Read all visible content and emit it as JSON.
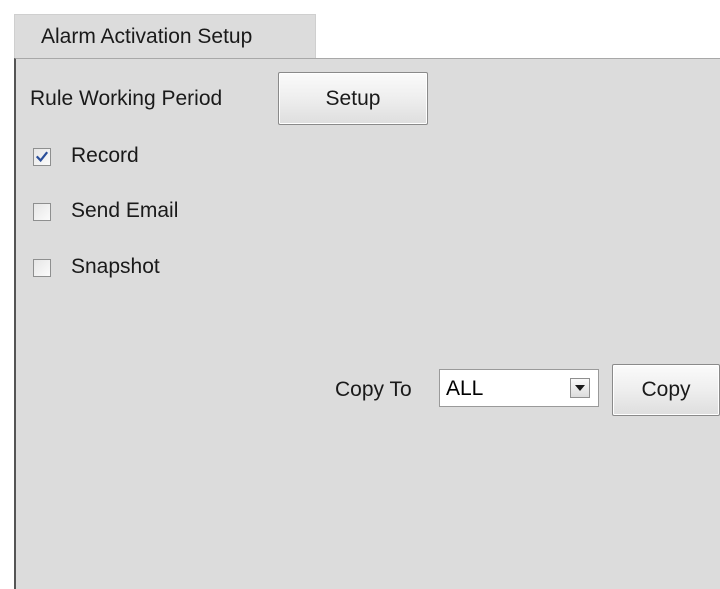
{
  "tab": {
    "label": "Alarm Activation Setup"
  },
  "rule_period": {
    "label": "Rule Working Period",
    "button_label": "Setup"
  },
  "actions": [
    {
      "label": "Record",
      "checked": true
    },
    {
      "label": "Send Email",
      "checked": false
    },
    {
      "label": "Snapshot",
      "checked": false
    }
  ],
  "copy": {
    "label": "Copy To",
    "selected": "ALL",
    "button_label": "Copy"
  },
  "icons": {
    "check": "checkmark-icon",
    "dropdown": "chevron-down-icon"
  },
  "colors": {
    "panel_bg": "#dcdcdc",
    "check_mark": "#2b4f9a"
  }
}
